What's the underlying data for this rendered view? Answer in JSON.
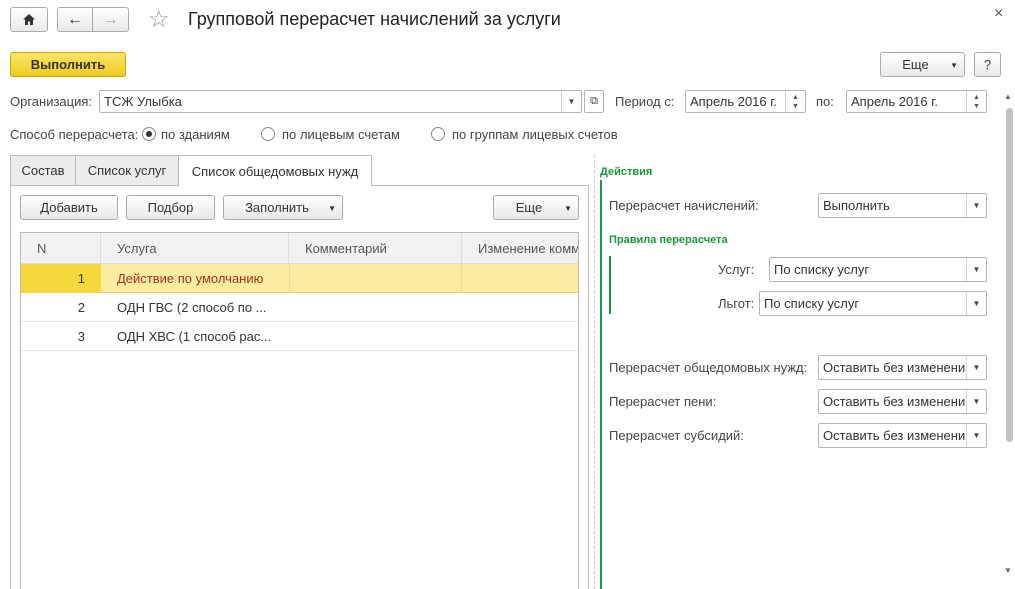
{
  "window": {
    "title": "Групповой перерасчет начислений за услуги",
    "close_glyph": "×"
  },
  "toolbar": {
    "execute_label": "Выполнить",
    "more_label": "Еще",
    "help_label": "?"
  },
  "org": {
    "label": "Организация:",
    "value": "ТСЖ Улыбка"
  },
  "period": {
    "from_label": "Период с:",
    "from_value": "Апрель 2016 г.",
    "to_label": "по:",
    "to_value": "Апрель 2016 г."
  },
  "method": {
    "label": "Способ перерасчета:",
    "options": [
      "по зданиям",
      "по лицевым счетам",
      "по группам лицевых счетов"
    ],
    "selected": 0
  },
  "tabs": [
    "Состав",
    "Список услуг",
    "Список общедомовых нужд"
  ],
  "active_tab": 2,
  "table_toolbar": {
    "add": "Добавить",
    "select": "Подбор",
    "fill": "Заполнить",
    "more": "Еще"
  },
  "table": {
    "columns": [
      "N",
      "Услуга",
      "Комментарий",
      "Изменение комм"
    ],
    "rows": [
      {
        "n": "1",
        "service": "Действие по умолчанию",
        "comment": "",
        "change": ""
      },
      {
        "n": "2",
        "service": "ОДН ГВС (2 способ по ...",
        "comment": "",
        "change": ""
      },
      {
        "n": "3",
        "service": "ОДН ХВС (1 способ рас...",
        "comment": "",
        "change": ""
      }
    ],
    "selected_row": 0
  },
  "actions": {
    "title": "Действия",
    "recalc_label": "Перерасчет начислений:",
    "recalc_value": "Выполнить",
    "rules_title": "Правила перерасчета",
    "services_label": "Услуг:",
    "services_value": "По списку услуг",
    "benefits_label": "Льгот:",
    "benefits_value": "По списку услуг",
    "common_label": "Перерасчет общедомовых нужд:",
    "common_value": "Оставить без изменени",
    "penalty_label": "Перерасчет пени:",
    "penalty_value": "Оставить без изменени",
    "subsidy_label": "Перерасчет субсидий:",
    "subsidy_value": "Оставить без изменени"
  },
  "colors": {
    "accent_yellow": "#f5d83a",
    "selected_row": "#fbeca0",
    "group_green": "#1a9a3a"
  }
}
